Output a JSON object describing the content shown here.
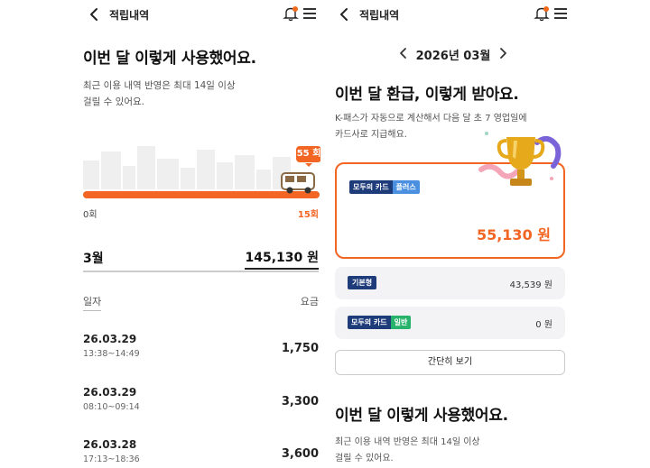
{
  "left": {
    "header": {
      "title": "적립내역",
      "back_icon": "chevron-left-icon",
      "bell_icon": "bell-icon",
      "menu_icon": "hamburger-menu-icon"
    },
    "headline": "이번 달 이렇게 사용했어요.",
    "subtext_line1": "최근 이용 내역 반영은 최대 14일 이상",
    "subtext_line2": "걸릴 수 있어요.",
    "progress": {
      "current_label": "55 회",
      "current": 55,
      "min_label": "0회",
      "max_label": "15회",
      "fill_fraction": 1.0
    },
    "month": {
      "label": "3월",
      "total": "145,130 원"
    },
    "columns": {
      "date": "일자",
      "fee": "요금"
    },
    "rows": [
      {
        "date": "26.03.29",
        "time": "13:38~14:49",
        "fee": "1,750"
      },
      {
        "date": "26.03.29",
        "time": "08:10~09:14",
        "fee": "3,300"
      },
      {
        "date": "26.03.28",
        "time": "17:13~18:36",
        "fee": "3,600"
      }
    ]
  },
  "right": {
    "header": {
      "title": "적립내역",
      "back_icon": "chevron-left-icon",
      "bell_icon": "bell-icon",
      "menu_icon": "hamburger-menu-icon"
    },
    "month_nav": {
      "label": "2026년 03월",
      "prev_icon": "chevron-left-icon",
      "next_icon": "chevron-right-icon"
    },
    "headline": "이번 달 환급, 이렇게 받아요.",
    "subtext_line1": "K-패스가 자동으로 계산해서 다음 달 초 7 영업일에",
    "subtext_line2": "카드사로 지급해요.",
    "refund_card": {
      "badge_card": "모두의 카드",
      "badge_type": "플러스",
      "amount": "55,130 원",
      "trophy_icon": "trophy-icon"
    },
    "basic": {
      "badge": "기본형",
      "value": "43,539 원"
    },
    "general": {
      "badge_card": "모두의 카드",
      "badge_type": "일반",
      "value": "0 원"
    },
    "simple_button": "간단히 보기",
    "headline2": "이번 달 이렇게 사용했어요.",
    "subtext2_line1": "최근 이용 내역 반영은 최대 14일 이상",
    "subtext2_line2": "걸릴 수 있어요."
  },
  "colors": {
    "accent": "#f26522",
    "navy": "#1f3c7a",
    "plus_blue": "#4a8fe0",
    "general_green": "#27b36b"
  }
}
